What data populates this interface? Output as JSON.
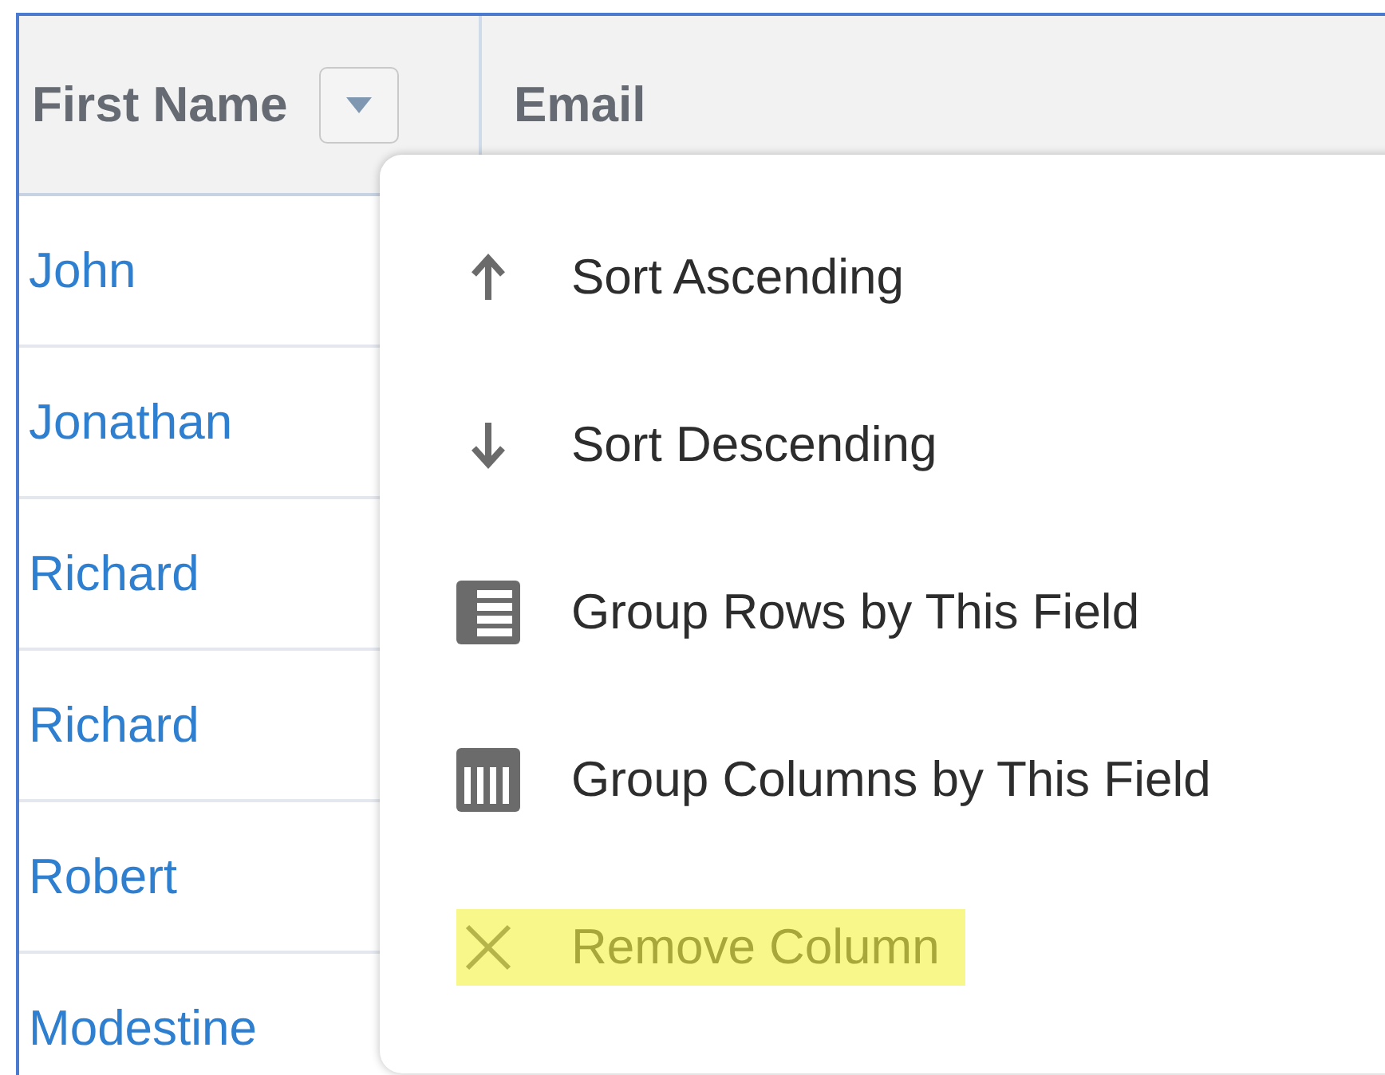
{
  "table": {
    "columns": [
      {
        "label": "First Name",
        "has_menu": true
      },
      {
        "label": "Email",
        "has_menu": false
      }
    ],
    "rows": [
      "John",
      "Jonathan",
      "Richard",
      "Richard",
      "Robert",
      "Modestine"
    ]
  },
  "column_menu": {
    "items": [
      {
        "kind": "sort-ascending",
        "label": "Sort Ascending",
        "highlighted": false
      },
      {
        "kind": "sort-descending",
        "label": "Sort Descending",
        "highlighted": false
      },
      {
        "kind": "group-rows",
        "label": "Group Rows by This Field",
        "highlighted": false
      },
      {
        "kind": "group-columns",
        "label": "Group Columns by This Field",
        "highlighted": false
      },
      {
        "kind": "remove",
        "label": "Remove Column",
        "highlighted": true
      }
    ]
  }
}
